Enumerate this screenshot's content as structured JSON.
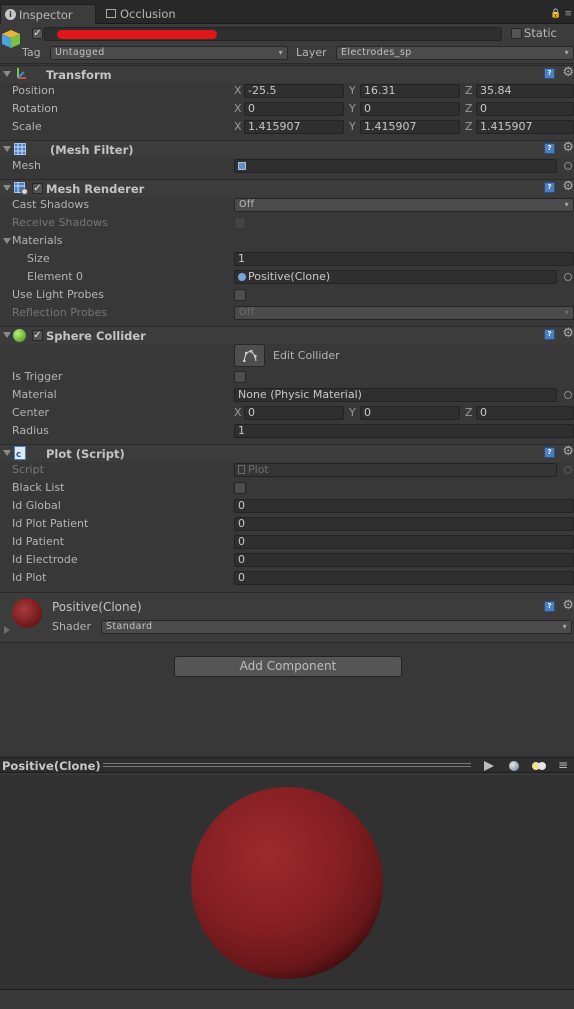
{
  "tabs": {
    "inspector": "Inspector",
    "occlusion": "Occlusion"
  },
  "header": {
    "active": true,
    "static_label": "Static",
    "tag_label": "Tag",
    "tag_value": "Untagged",
    "layer_label": "Layer",
    "layer_value": "Electrodes_sp"
  },
  "transform": {
    "title": "Transform",
    "position_label": "Position",
    "position": {
      "x": "-25.5",
      "y": "16.31",
      "z": "35.84"
    },
    "rotation_label": "Rotation",
    "rotation": {
      "x": "0",
      "y": "0",
      "z": "0"
    },
    "scale_label": "Scale",
    "scale": {
      "x": "1.415907",
      "y": "1.415907",
      "z": "1.415907"
    }
  },
  "axes": {
    "x": "X",
    "y": "Y",
    "z": "Z"
  },
  "mesh_filter": {
    "title": "(Mesh Filter)",
    "mesh_label": "Mesh"
  },
  "mesh_renderer": {
    "title": "Mesh Renderer",
    "cast_shadows_label": "Cast Shadows",
    "cast_shadows_value": "Off",
    "receive_shadows_label": "Receive Shadows",
    "materials_label": "Materials",
    "size_label": "Size",
    "size_value": "1",
    "element0_label": "Element 0",
    "element0_value": "Positive(Clone)",
    "light_probes_label": "Use Light Probes",
    "reflection_probes_label": "Reflection Probes",
    "reflection_probes_value": "Off"
  },
  "sphere_collider": {
    "title": "Sphere Collider",
    "edit_label": "Edit Collider",
    "trigger_label": "Is Trigger",
    "material_label": "Material",
    "material_value": "None (Physic Material)",
    "center_label": "Center",
    "center": {
      "x": "0",
      "y": "0",
      "z": "0"
    },
    "radius_label": "Radius",
    "radius_value": "1"
  },
  "plot_script": {
    "title": "Plot (Script)",
    "script_label": "Script",
    "script_value": "Plot",
    "black_list_label": "Black List",
    "id_global_label": "Id Global",
    "id_global": "0",
    "id_plot_patient_label": "Id Plot Patient",
    "id_plot_patient": "0",
    "id_patient_label": "Id Patient",
    "id_patient": "0",
    "id_electrode_label": "Id Electrode",
    "id_electrode": "0",
    "id_plot_label": "Id Plot",
    "id_plot": "0"
  },
  "material": {
    "name": "Positive(Clone)",
    "shader_label": "Shader",
    "shader_value": "Standard",
    "color": "#8b1e22"
  },
  "add_component": "Add Component",
  "preview": {
    "title": "Positive(Clone)"
  }
}
